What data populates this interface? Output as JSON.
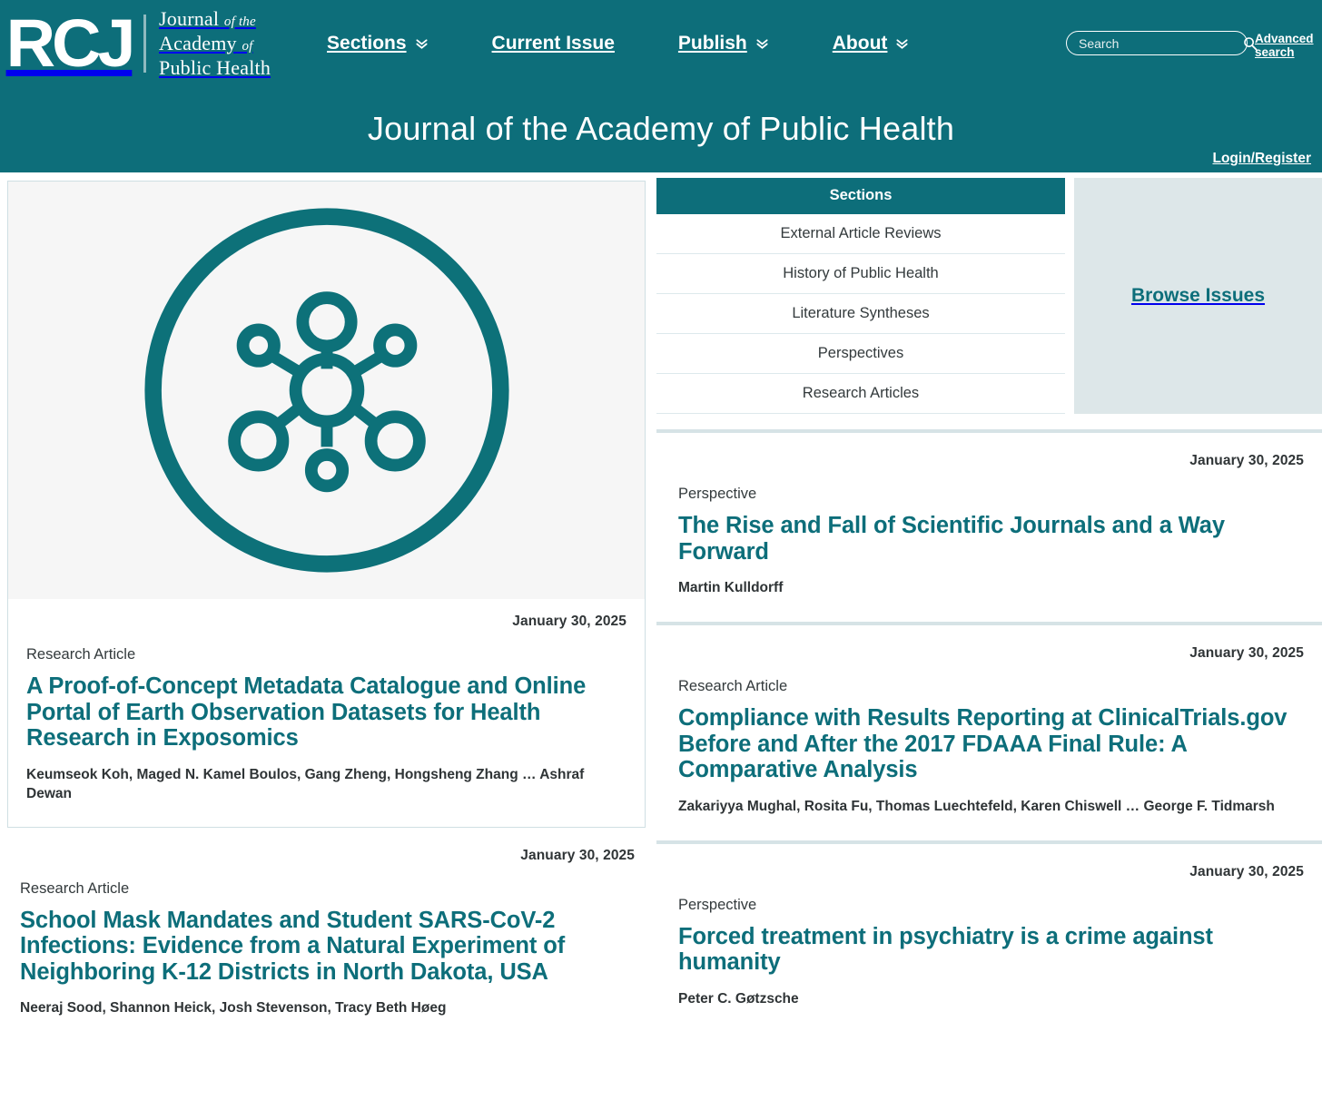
{
  "theme": {
    "teal": "#0d6e7a",
    "panel_bg": "#dde7e9",
    "divider": "#d6e3e6",
    "image_bg": "#f6f6f6"
  },
  "header": {
    "logo_mark": "RCJ",
    "logo_line1_main": "Journal",
    "logo_line1_small": "of the",
    "logo_line2_main": "Academy",
    "logo_line2_small": "of",
    "logo_line3_main": "Public Health",
    "nav": [
      {
        "label": "Sections",
        "has_dropdown": true
      },
      {
        "label": "Current Issue",
        "has_dropdown": false
      },
      {
        "label": "Publish",
        "has_dropdown": true
      },
      {
        "label": "About",
        "has_dropdown": true
      }
    ],
    "search": {
      "placeholder": "Search",
      "value": "",
      "icon": "search-icon"
    },
    "advanced_search": "Advanced search"
  },
  "banner": {
    "title": "Journal of the Academy of Public Health",
    "login": "Login/Register"
  },
  "sections_panel": {
    "heading": "Sections",
    "items": [
      "External Article Reviews",
      "History of Public Health",
      "Literature Syntheses",
      "Perspectives",
      "Research Articles"
    ]
  },
  "browse_issues": {
    "label": "Browse Issues"
  },
  "featured": {
    "image_icon": "network-nodes-icon",
    "date": "January 30, 2025",
    "kind": "Research Article",
    "title": "A Proof-of-Concept Metadata Catalogue and Online Portal of Earth Observation Datasets for Health Research in Exposomics",
    "authors": "Keumseok Koh, Maged N. Kamel Boulos, Gang Zheng, Hongsheng Zhang … Ashraf Dewan"
  },
  "left_articles": [
    {
      "date": "January 30, 2025",
      "kind": "Research Article",
      "title": "School Mask Mandates and Student SARS-CoV-2 Infections: Evidence from a Natural Experiment of Neighboring K-12 Districts in North Dakota, USA",
      "authors": "Neeraj Sood, Shannon Heick, Josh Stevenson, Tracy Beth Høeg"
    }
  ],
  "right_articles": [
    {
      "date": "January 30, 2025",
      "kind": "Perspective",
      "title": "The Rise and Fall of Scientific Journals and a Way Forward",
      "authors": "Martin Kulldorff"
    },
    {
      "date": "January 30, 2025",
      "kind": "Research Article",
      "title": "Compliance with Results Reporting at ClinicalTrials.gov Before and After the 2017 FDAAA Final Rule: A Comparative Analysis",
      "authors": "Zakariyya Mughal, Rosita Fu, Thomas Luechtefeld, Karen Chiswell … George F. Tidmarsh"
    },
    {
      "date": "January 30, 2025",
      "kind": "Perspective",
      "title": "Forced treatment in psychiatry is a crime against humanity",
      "authors": "Peter C. Gøtzsche"
    }
  ]
}
